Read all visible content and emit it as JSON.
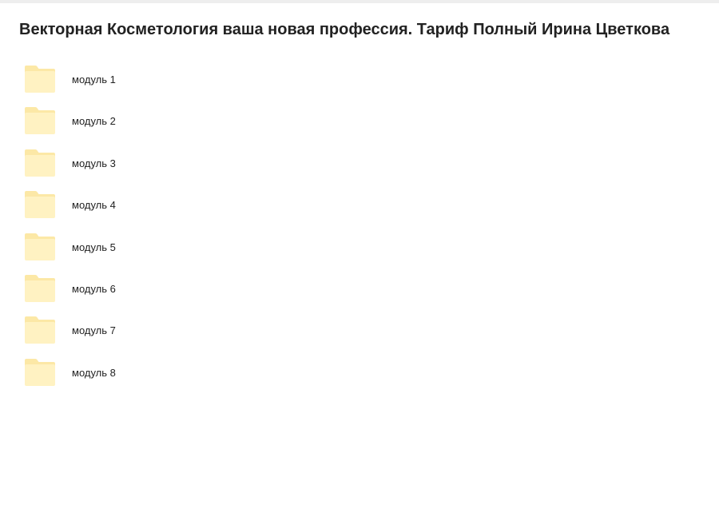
{
  "folder": {
    "title": "Векторная Косметология ваша новая профессия. Тариф Полный Ирина Цветкова"
  },
  "items": [
    {
      "name": "модуль 1",
      "icon": "folder-icon"
    },
    {
      "name": "модуль 2",
      "icon": "folder-icon"
    },
    {
      "name": "модуль 3",
      "icon": "folder-icon"
    },
    {
      "name": "модуль 4",
      "icon": "folder-icon"
    },
    {
      "name": "модуль 5",
      "icon": "folder-icon"
    },
    {
      "name": "модуль 6",
      "icon": "folder-icon"
    },
    {
      "name": "модуль 7",
      "icon": "folder-icon"
    },
    {
      "name": "модуль 8",
      "icon": "folder-icon"
    }
  ],
  "colors": {
    "folder_back": "#fce8a6",
    "folder_front": "#fff2c2",
    "text": "#222222"
  }
}
